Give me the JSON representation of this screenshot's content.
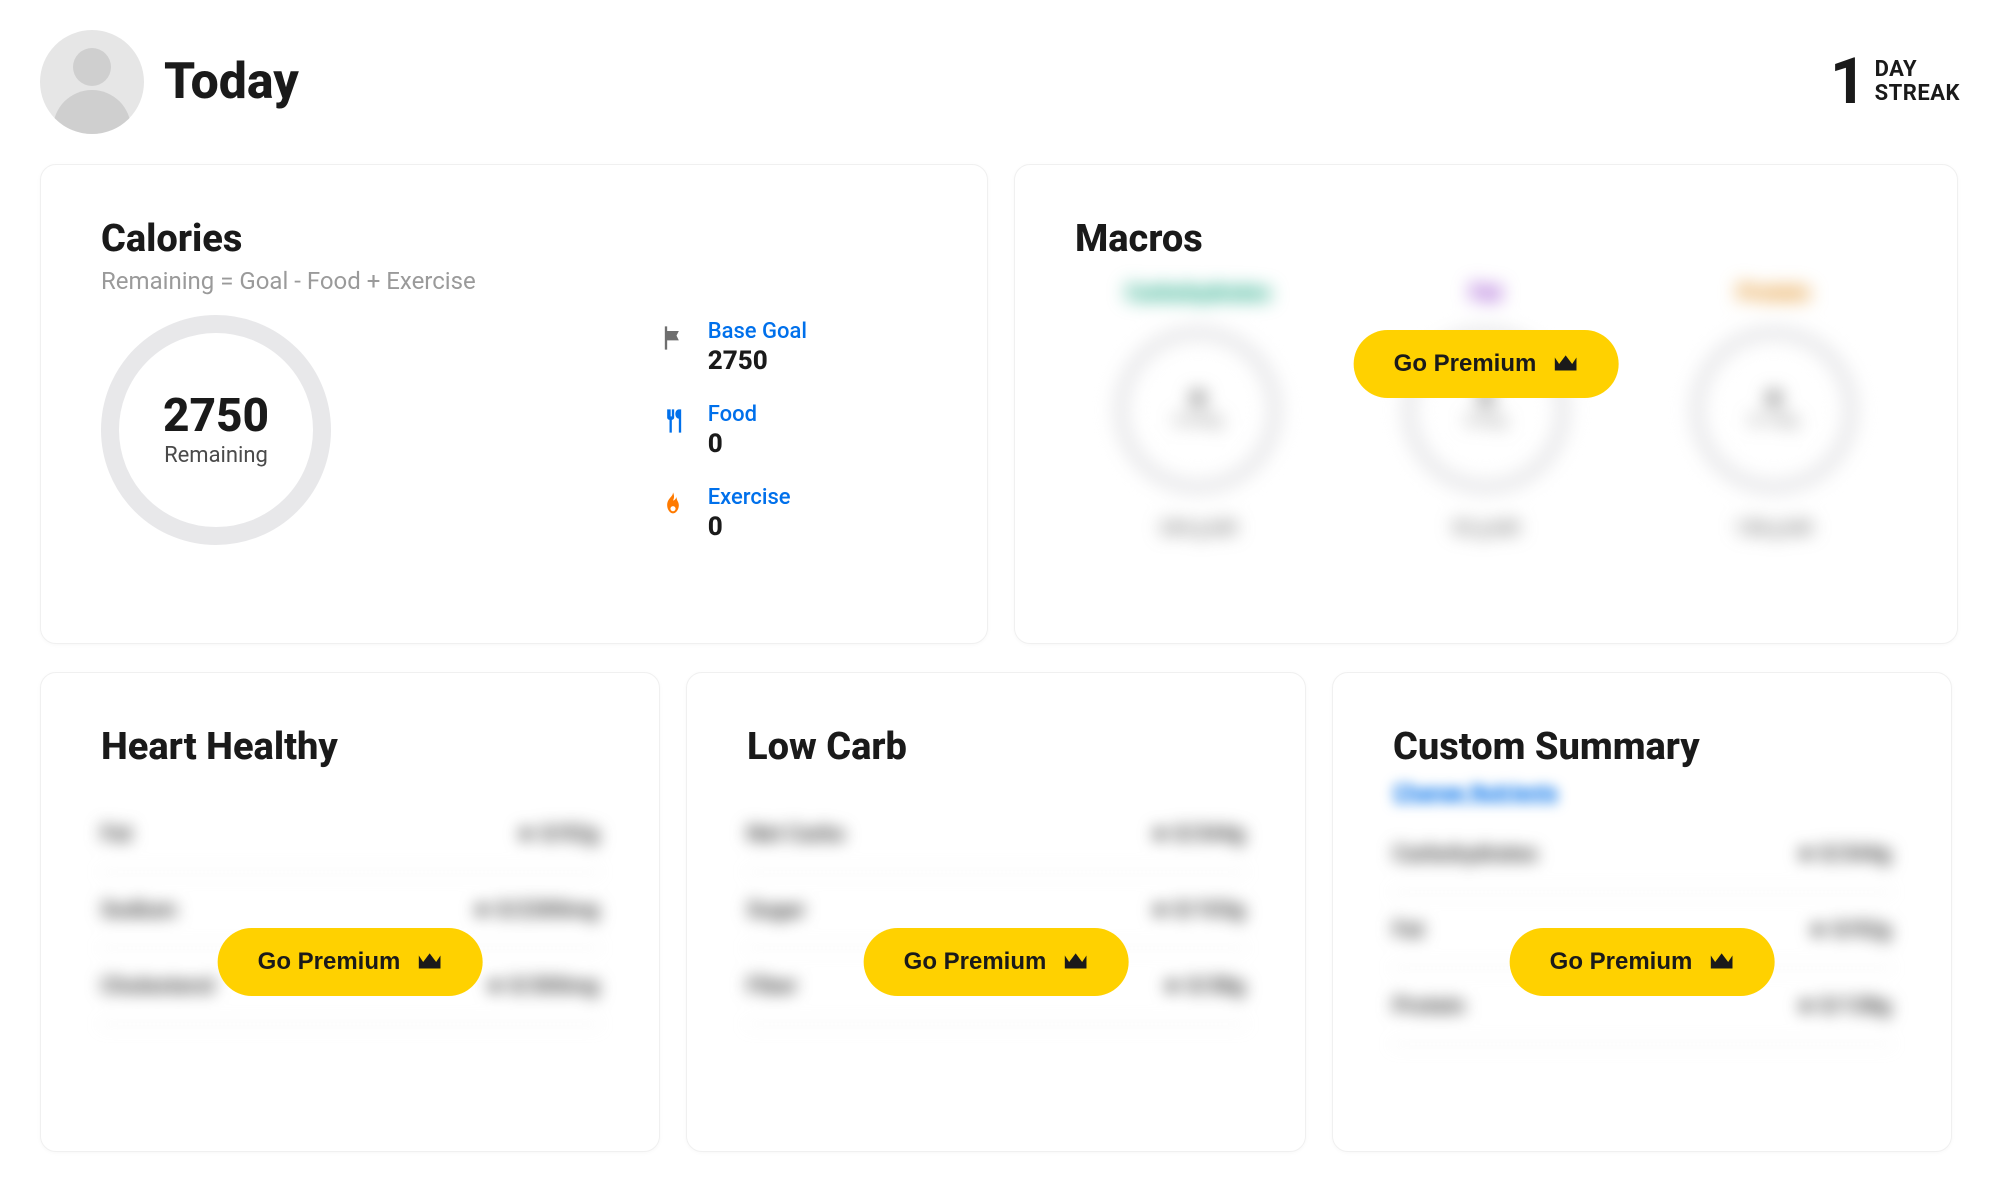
{
  "header": {
    "title": "Today",
    "streak": {
      "number": "1",
      "label_line1": "DAY",
      "label_line2": "STREAK"
    }
  },
  "calories": {
    "title": "Calories",
    "subtitle": "Remaining = Goal - Food + Exercise",
    "ring": {
      "value": "2750",
      "label": "Remaining"
    },
    "stats": {
      "base_goal": {
        "label": "Base Goal",
        "value": "2750"
      },
      "food": {
        "label": "Food",
        "value": "0"
      },
      "exercise": {
        "label": "Exercise",
        "value": "0"
      }
    }
  },
  "macros": {
    "title": "Macros",
    "premium_label": "Go Premium",
    "items": [
      {
        "name": "Carbohydrates",
        "ring_text": "0/344g",
        "left_text": "344 g left"
      },
      {
        "name": "Fat",
        "ring_text": "0/92g",
        "left_text": "92 g left"
      },
      {
        "name": "Protein",
        "ring_text": "0/138g",
        "left_text": "138 g left"
      }
    ]
  },
  "heart": {
    "title": "Heart Healthy",
    "premium_label": "Go Premium",
    "rows": [
      {
        "name": "Fat",
        "value": "0/92g"
      },
      {
        "name": "Sodium",
        "value": "0/2300mg"
      },
      {
        "name": "Cholesterol",
        "value": "0/300mg"
      }
    ]
  },
  "lowcarb": {
    "title": "Low Carb",
    "premium_label": "Go Premium",
    "rows": [
      {
        "name": "Net Carbs",
        "value": "0/344g"
      },
      {
        "name": "Sugar",
        "value": "0/103g"
      },
      {
        "name": "Fiber",
        "value": "0/38g"
      }
    ]
  },
  "custom": {
    "title": "Custom Summary",
    "change_label": "Change Nutrients",
    "premium_label": "Go Premium",
    "rows": [
      {
        "name": "Carbohydrates",
        "value": "0/344g"
      },
      {
        "name": "Fat",
        "value": "0/92g"
      },
      {
        "name": "Protein",
        "value": "0/138g"
      }
    ]
  }
}
